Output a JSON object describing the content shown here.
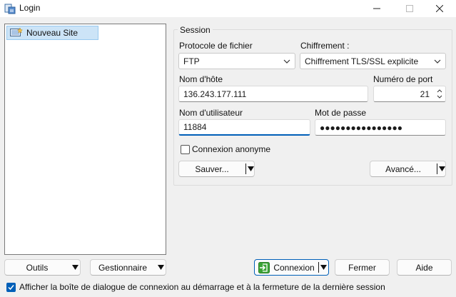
{
  "window": {
    "title": "Login"
  },
  "site_tree": {
    "items": [
      {
        "label": "Nouveau Site"
      }
    ]
  },
  "session": {
    "legend": "Session",
    "protocol_label": "Protocole de fichier",
    "protocol_value": "FTP",
    "encryption_label": "Chiffrement :",
    "encryption_value": "Chiffrement TLS/SSL explicite",
    "host_label": "Nom d'hôte",
    "host_value": "136.243.177.111",
    "port_label": "Numéro de port",
    "port_value": "21",
    "user_label": "Nom d'utilisateur",
    "user_value": "11884",
    "password_label": "Mot de passe",
    "password_mask": "●●●●●●●●●●●●●●●●",
    "anonymous_label": "Connexion anonyme",
    "anonymous_checked": false,
    "save_button": "Sauver...",
    "advanced_button": "Avancé..."
  },
  "footer": {
    "tools_button": "Outils",
    "manager_button": "Gestionnaire",
    "connect_button": "Connexion",
    "close_button": "Fermer",
    "help_button": "Aide",
    "show_dialog_label": "Afficher la boîte de dialogue de connexion au démarrage et à la fermeture de la dernière session",
    "show_dialog_checked": true
  },
  "colors": {
    "accent": "#005fb8",
    "selection": "#cce4f7"
  }
}
